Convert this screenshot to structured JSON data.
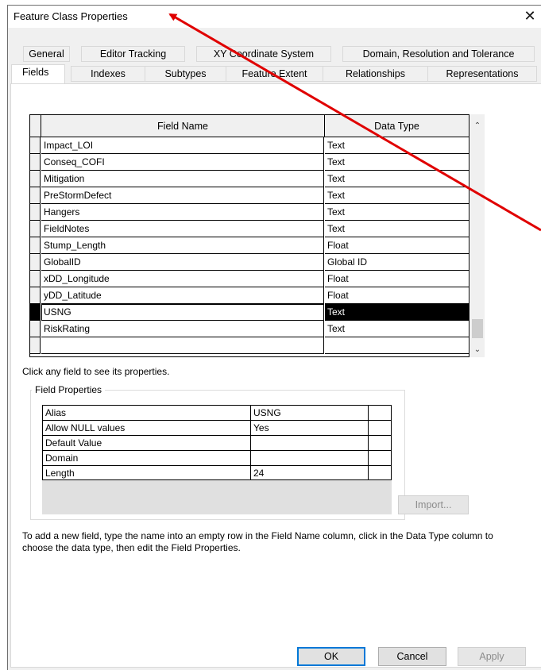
{
  "window": {
    "title": "Feature Class Properties",
    "close_glyph": "✕"
  },
  "tabs_row1": [
    "General",
    "Editor Tracking",
    "XY Coordinate System",
    "Domain, Resolution and Tolerance"
  ],
  "tabs_row2": [
    "Fields",
    "Indexes",
    "Subtypes",
    "Feature Extent",
    "Relationships",
    "Representations"
  ],
  "active_tab": "Fields",
  "grid": {
    "headers": {
      "name": "Field Name",
      "type": "Data Type"
    },
    "rows": [
      {
        "name": "Impact_LOI",
        "type": "Text"
      },
      {
        "name": "Conseq_COFI",
        "type": "Text"
      },
      {
        "name": "Mitigation",
        "type": "Text"
      },
      {
        "name": "PreStormDefect",
        "type": "Text"
      },
      {
        "name": "Hangers",
        "type": "Text"
      },
      {
        "name": "FieldNotes",
        "type": "Text"
      },
      {
        "name": "Stump_Length",
        "type": "Float"
      },
      {
        "name": "GlobalID",
        "type": "Global ID"
      },
      {
        "name": "xDD_Longitude",
        "type": "Float"
      },
      {
        "name": "yDD_Latitude",
        "type": "Float"
      },
      {
        "name": "USNG",
        "type": "Text"
      },
      {
        "name": "RiskRating",
        "type": "Text"
      },
      {
        "name": "",
        "type": ""
      }
    ],
    "selected_index": 10
  },
  "hint": "Click any field to see its properties.",
  "field_properties": {
    "legend": "Field Properties",
    "rows": [
      {
        "key": "Alias",
        "value": "USNG"
      },
      {
        "key": "Allow NULL values",
        "value": "Yes"
      },
      {
        "key": "Default Value",
        "value": ""
      },
      {
        "key": "Domain",
        "value": ""
      },
      {
        "key": "Length",
        "value": "24"
      }
    ],
    "import_label": "Import..."
  },
  "footer_text": "To add a new field, type the name into an empty row in the Field Name column, click in the Data Type column to choose the data type, then edit the Field Properties.",
  "buttons": {
    "ok": "OK",
    "cancel": "Cancel",
    "apply": "Apply"
  },
  "colors": {
    "arrow": "#e00000",
    "accent": "#0078d7"
  },
  "icons": {
    "scroll_up": "up-chevron-icon",
    "scroll_down": "down-chevron-icon"
  }
}
